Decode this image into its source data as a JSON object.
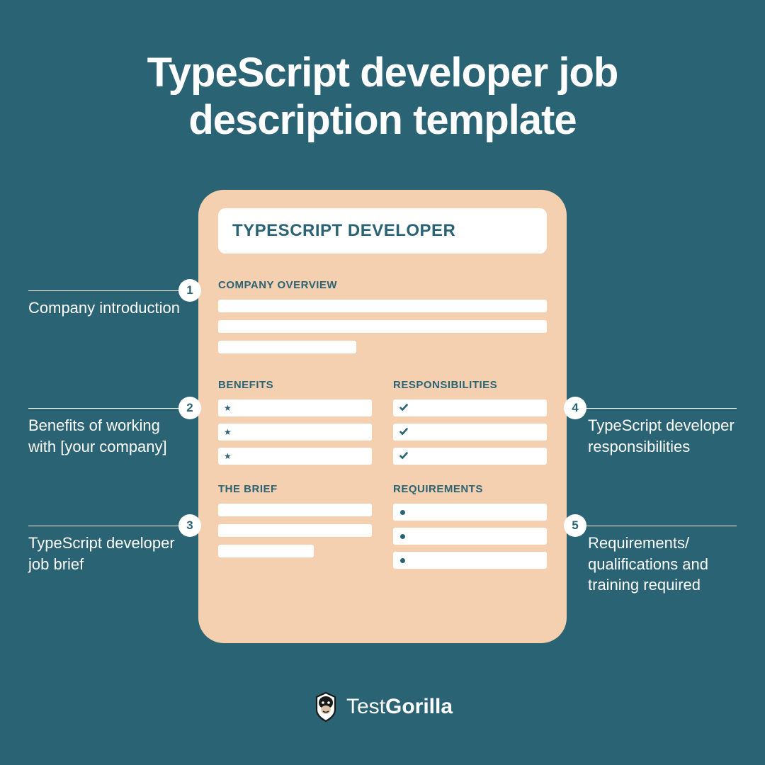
{
  "title": "TypeScript developer job description template",
  "card": {
    "header": "TYPESCRIPT DEVELOPER",
    "overview_label": "COMPANY OVERVIEW",
    "benefits_label": "BENEFITS",
    "responsibilities_label": "RESPONSIBILITIES",
    "brief_label": "THE BRIEF",
    "requirements_label": "REQUIREMENTS"
  },
  "annotations": {
    "a1": {
      "num": "1",
      "text": "Company introduction"
    },
    "a2": {
      "num": "2",
      "text": "Benefits of working with [your company]"
    },
    "a3": {
      "num": "3",
      "text": "TypeScript developer job brief"
    },
    "a4": {
      "num": "4",
      "text": "TypeScript developer responsibilities"
    },
    "a5": {
      "num": "5",
      "text": "Requirements/ qualifications and training required"
    }
  },
  "footer": {
    "brand1": "Test",
    "brand2": "Gorilla"
  }
}
